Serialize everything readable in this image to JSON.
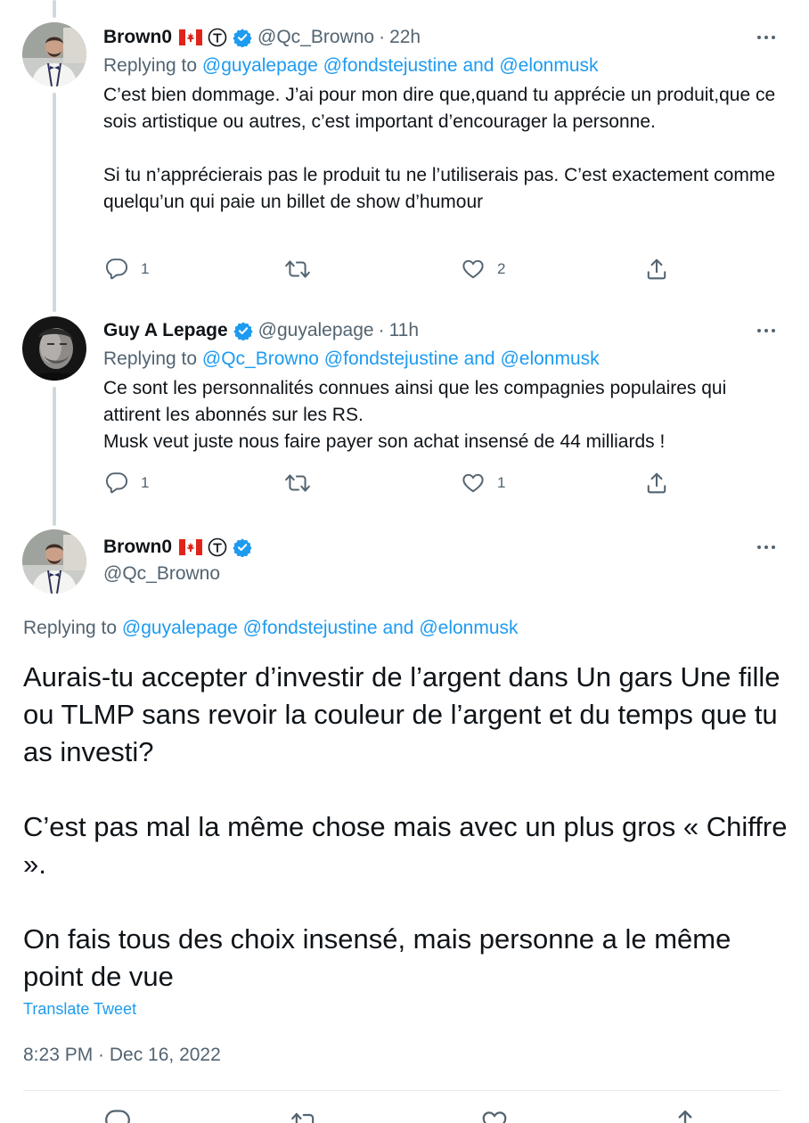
{
  "tweets": [
    {
      "name": "Brown0",
      "handle": "@Qc_Browno",
      "separator": "·",
      "time": "22h",
      "replying_prefix": "Replying to",
      "mentions": [
        "@guyalepage",
        "@fondstejustine",
        "@elonmusk"
      ],
      "joiner": "and",
      "paragraphs": [
        "C’est bien dommage. J’ai pour mon dire que,quand tu apprécie un produit,que ce sois artistique ou autres, c’est important d’encourager la personne.",
        "Si tu n’apprécierais pas le produit tu ne l’utiliserais pas. C’est exactement comme quelqu’un qui paie un billet de show d’humour"
      ],
      "counts": {
        "reply": "1",
        "retweet": "",
        "like": "2"
      }
    },
    {
      "name": "Guy A Lepage",
      "handle": "@guyalepage",
      "separator": "·",
      "time": "11h",
      "replying_prefix": "Replying to",
      "mentions": [
        "@Qc_Browno",
        "@fondstejustine",
        "@elonmusk"
      ],
      "joiner": "and",
      "paragraphs": [
        "Ce sont les personnalités connues ainsi que les compagnies populaires qui attirent les abonnés sur les RS.",
        "Musk veut juste nous faire payer son achat insensé de 44 milliards !"
      ],
      "counts": {
        "reply": "1",
        "retweet": "",
        "like": "1"
      }
    }
  ],
  "main_tweet": {
    "name": "Brown0",
    "handle": "@Qc_Browno",
    "replying_prefix": "Replying to",
    "mentions": [
      "@guyalepage",
      "@fondstejustine",
      "@elonmusk"
    ],
    "joiner": "and",
    "paragraphs": [
      "Aurais-tu accepter d’investir de l’argent dans Un gars Une fille ou TLMP sans revoir la couleur de l’argent et du temps que tu as investi?",
      "C’est pas mal la même chose mais avec un plus gros « Chiffre ».",
      "On fais tous des choix insensé, mais personne a le même point de vue"
    ],
    "translate_label": "Translate Tweet",
    "timestamp": "8:23 PM · Dec 16, 2022"
  },
  "icons": {
    "reply": "reply-icon",
    "retweet": "retweet-icon",
    "like": "like-icon",
    "share": "share-icon",
    "more": "more-icon",
    "verified": "verified-badge-icon",
    "flag": "canada-flag-icon",
    "t_badge": "circled-t-icon"
  },
  "colors": {
    "accent": "#1d9bf0",
    "secondary_text": "#536471",
    "thread_line": "#cfd9de"
  }
}
